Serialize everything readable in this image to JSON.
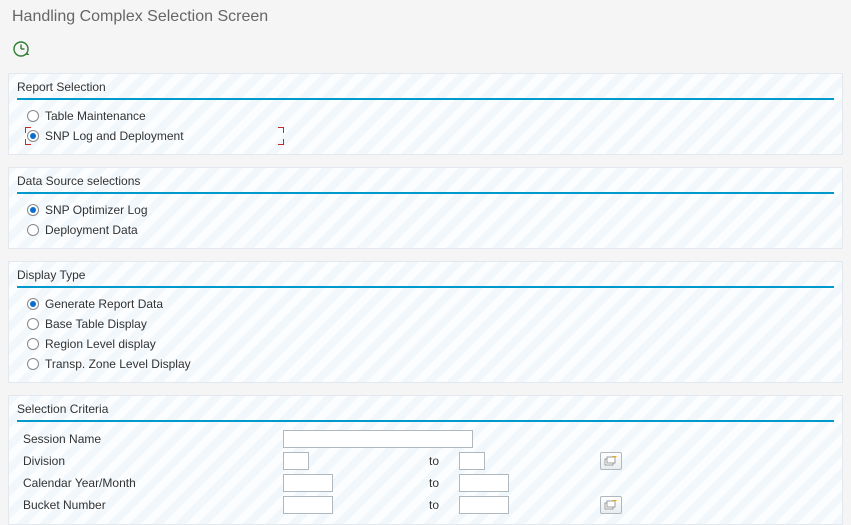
{
  "title": "Handling Complex Selection Screen",
  "groups": {
    "reportSelection": {
      "title": "Report Selection",
      "options": [
        {
          "label": "Table Maintenance",
          "checked": false,
          "highlighted": false
        },
        {
          "label": "SNP Log and Deployment",
          "checked": true,
          "highlighted": true
        }
      ]
    },
    "dataSource": {
      "title": "Data Source selections",
      "options": [
        {
          "label": "SNP Optimizer Log",
          "checked": true
        },
        {
          "label": "Deployment Data",
          "checked": false
        }
      ]
    },
    "displayType": {
      "title": "Display Type",
      "options": [
        {
          "label": "Generate Report Data",
          "checked": true
        },
        {
          "label": "Base Table Display",
          "checked": false
        },
        {
          "label": "Region Level display",
          "checked": false
        },
        {
          "label": "Transp. Zone Level Display",
          "checked": false
        }
      ]
    },
    "selectionCriteria": {
      "title": "Selection Criteria",
      "fields": {
        "sessionName": {
          "label": "Session Name",
          "value": ""
        },
        "division": {
          "label": "Division",
          "from": "",
          "to": "",
          "toLabel": "to"
        },
        "calYearMonth": {
          "label": "Calendar Year/Month",
          "from": "",
          "to": "",
          "toLabel": "to"
        },
        "bucketNumber": {
          "label": "Bucket Number",
          "from": "",
          "to": "",
          "toLabel": "to"
        }
      }
    }
  }
}
